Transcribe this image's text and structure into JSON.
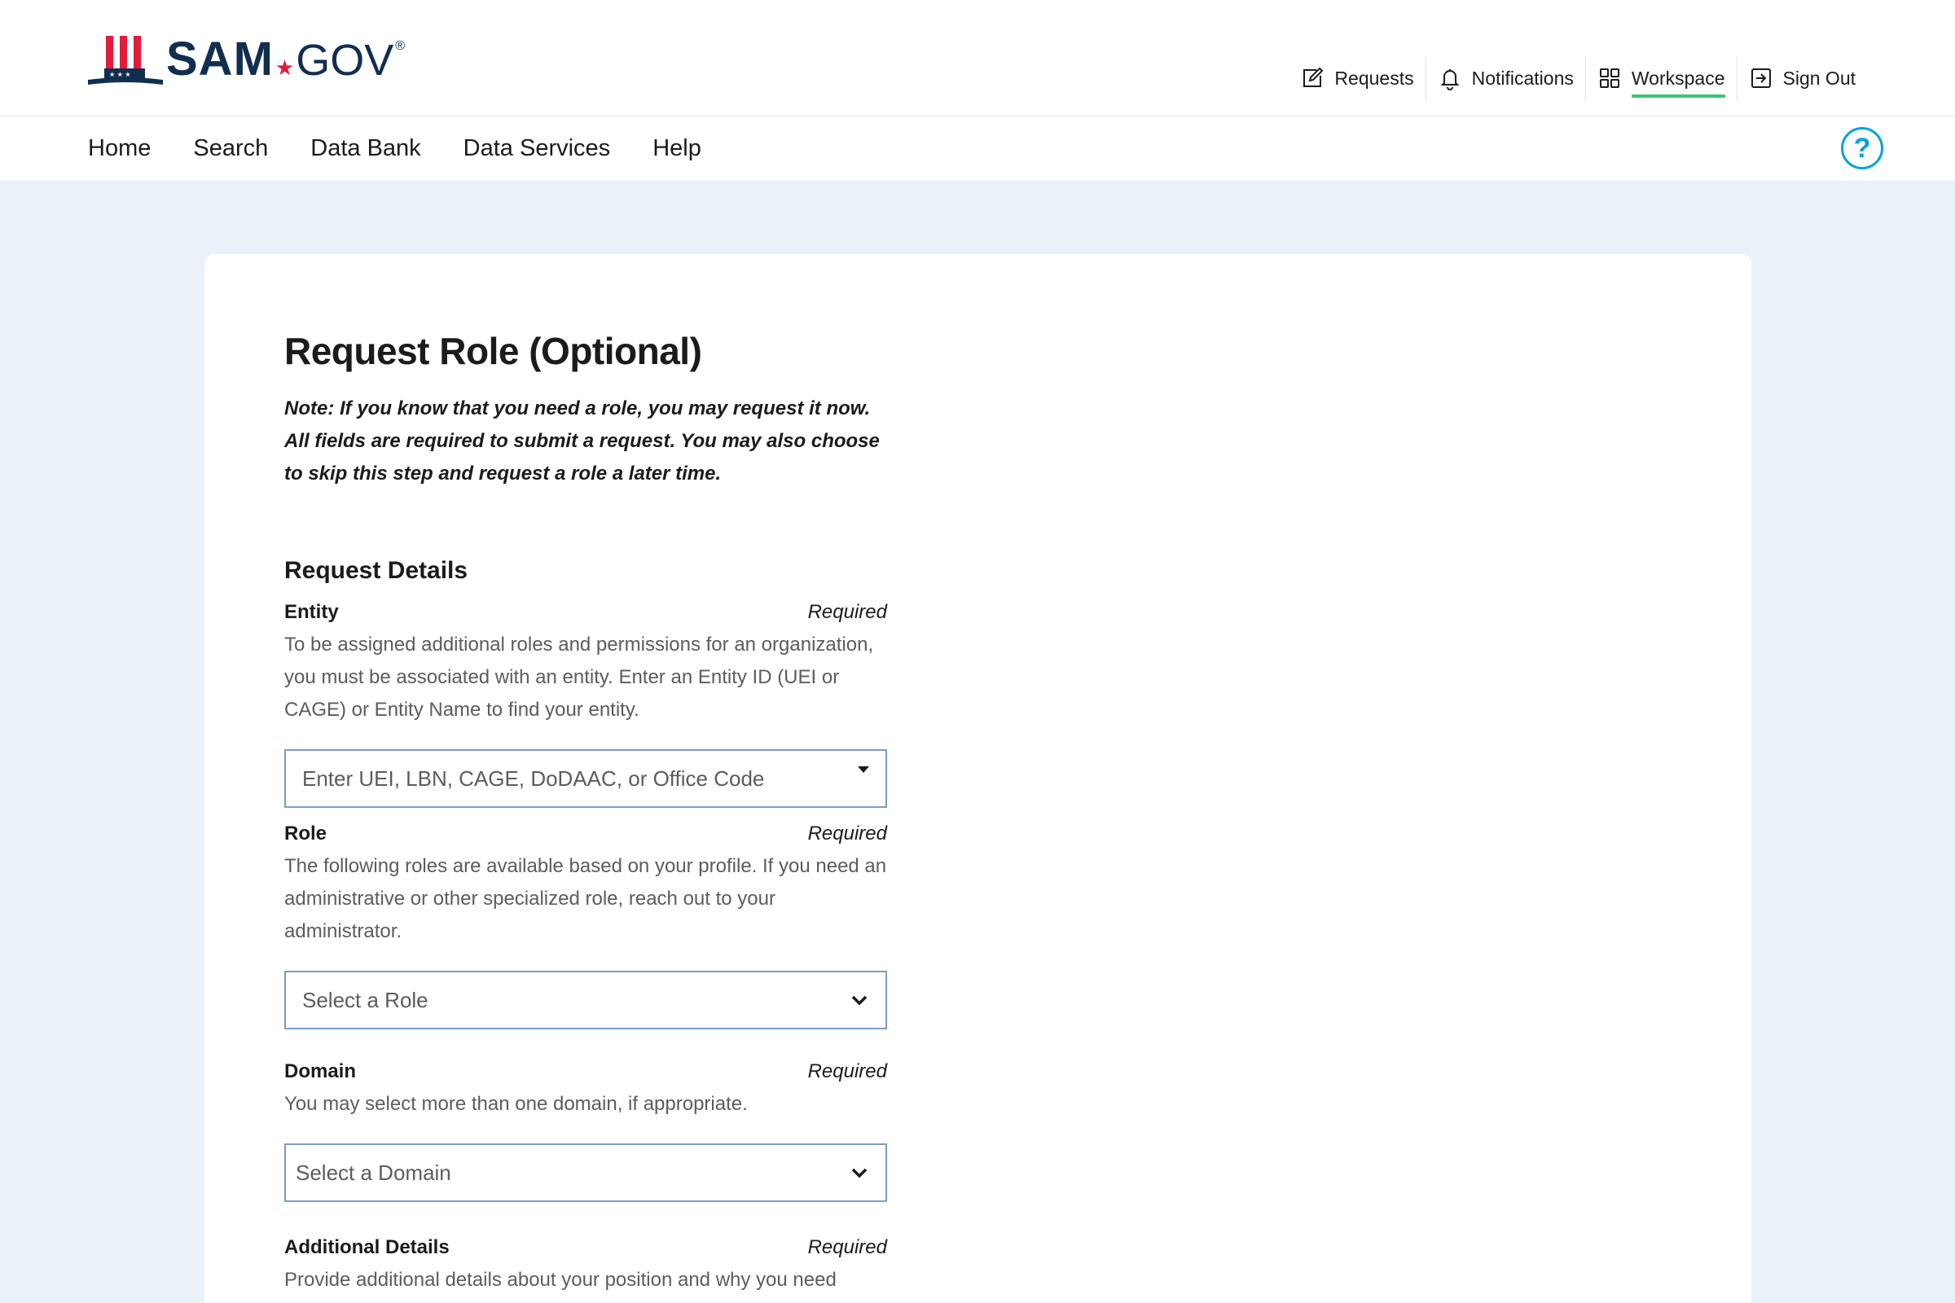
{
  "header": {
    "logo_sam": "SAM",
    "logo_gov": "GOV",
    "logo_reg": "®",
    "util_nav": [
      {
        "label": "Requests",
        "icon": "edit-icon"
      },
      {
        "label": "Notifications",
        "icon": "bell-icon"
      },
      {
        "label": "Workspace",
        "icon": "grid-icon",
        "active": true
      },
      {
        "label": "Sign Out",
        "icon": "sign-out-icon"
      }
    ],
    "accent_color": "#3bc47a"
  },
  "main_nav": {
    "items": [
      "Home",
      "Search",
      "Data Bank",
      "Data Services",
      "Help"
    ],
    "help_icon": "?"
  },
  "page": {
    "title": "Request Role (Optional)",
    "note": "Note: If you know that you need a role, you may request it now. All fields are required to submit a request. You may also choose to skip this step and request a role a later time.",
    "section_title": "Request Details",
    "entity": {
      "label": "Entity",
      "required": "Required",
      "description": "To be assigned additional roles and permissions for an organization, you must be associated with an entity. Enter an Entity ID (UEI or CAGE) or Entity Name to find your entity.",
      "placeholder": "Enter UEI, LBN, CAGE, DoDAAC, or Office Code"
    },
    "role": {
      "label": "Role",
      "required": "Required",
      "description": "The following roles are available based on your profile. If you need an administrative or other specialized role, reach out to your administrator.",
      "placeholder": "Select a Role"
    },
    "domain": {
      "label": "Domain",
      "required": "Required",
      "description": "You may select more than one domain, if appropriate.",
      "placeholder": "Select a Domain"
    },
    "additional": {
      "label": "Additional Details",
      "required": "Required",
      "description": "Provide additional details about your position and why you need"
    }
  }
}
